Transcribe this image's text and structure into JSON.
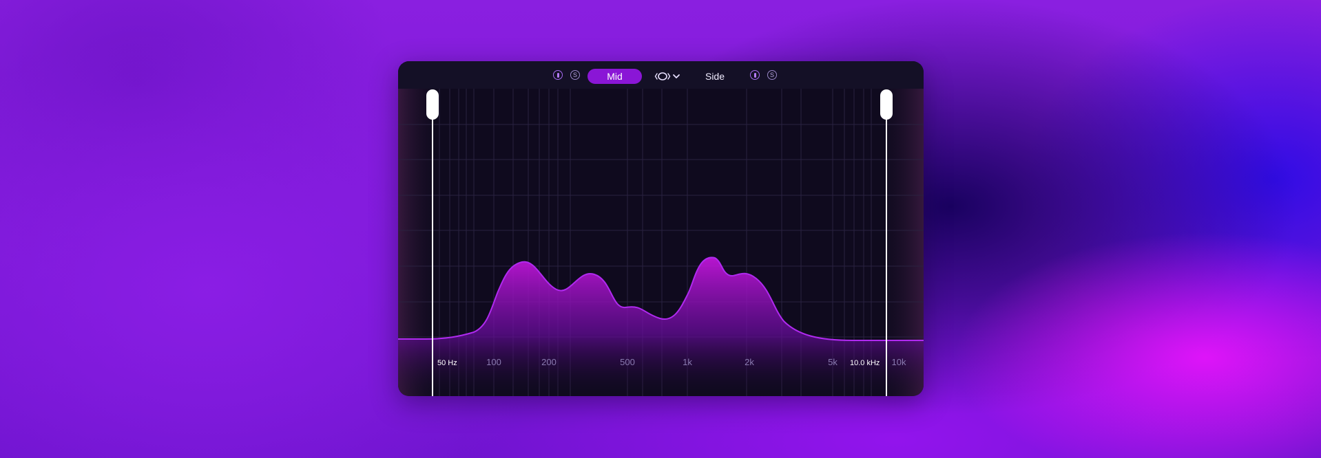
{
  "toolbar": {
    "mid_label": "Mid",
    "side_label": "Side",
    "mid_solo_label": "S",
    "side_solo_label": "S",
    "link_icon": "stereo-link-icon",
    "dropdown_icon": "chevron-down-icon"
  },
  "analyzer": {
    "frequency_axis": [
      "100",
      "200",
      "500",
      "1k",
      "2k",
      "5k",
      "10k"
    ],
    "low_range_label": "50 Hz",
    "high_range_label": "10.0 kHz"
  },
  "colors": {
    "accent": "#8a16d6",
    "curve": "#a628e6",
    "panel": "#0f0a1e"
  }
}
